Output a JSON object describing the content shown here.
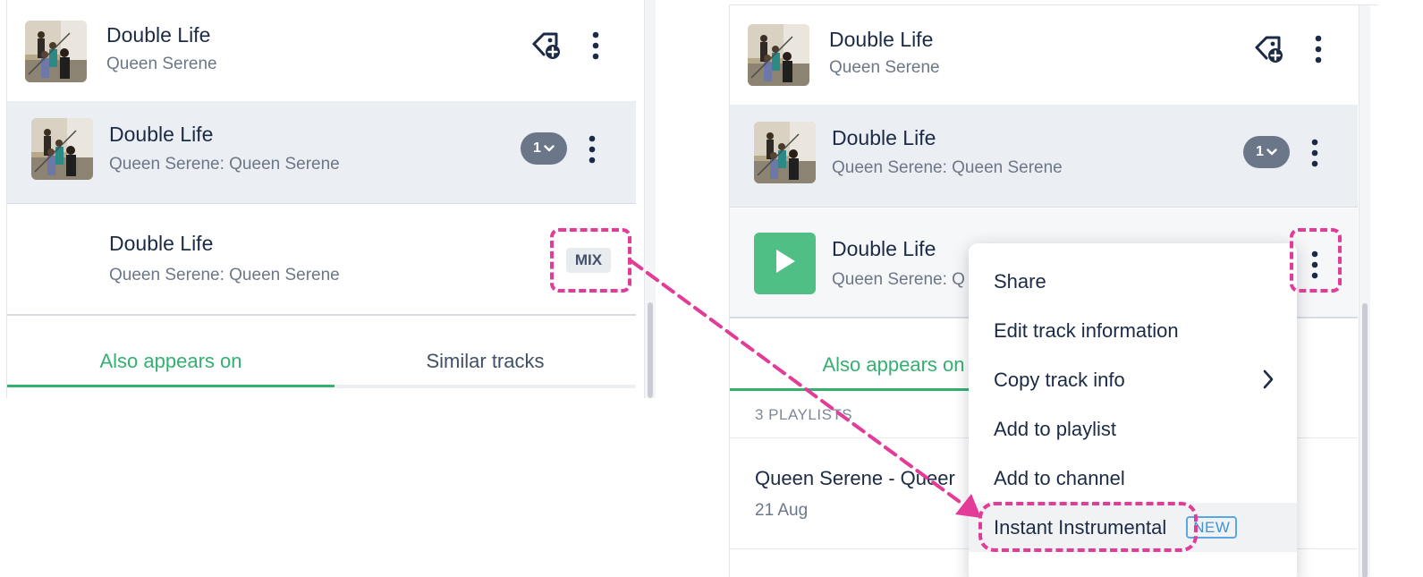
{
  "left_panel": {
    "header_track": {
      "title": "Double Life",
      "artist": "Queen Serene"
    },
    "version_track": {
      "title": "Double Life",
      "subtitle": "Queen Serene: Queen Serene",
      "count": "1"
    },
    "mix_track": {
      "title": "Double Life",
      "subtitle": "Queen Serene: Queen Serene",
      "badge": "MIX"
    },
    "tabs": [
      "Also appears on",
      "Similar tracks"
    ]
  },
  "right_panel": {
    "header_track": {
      "title": "Double Life",
      "artist": "Queen Serene"
    },
    "version_track": {
      "title": "Double Life",
      "subtitle": "Queen Serene: Queen Serene",
      "count": "1"
    },
    "mix_track": {
      "title": "Double Life",
      "subtitle": "Queen Serene: Q"
    },
    "tabs": [
      "Also appears on"
    ],
    "section_label": "3 PLAYLISTS",
    "playlist": {
      "title": "Queen Serene - Queer",
      "date": "21 Aug"
    }
  },
  "context_menu": {
    "items": [
      "Share",
      "Edit track information",
      "Copy track info",
      "Add to playlist",
      "Add to channel",
      "Instant Instrumental"
    ],
    "new_badge": "NEW"
  },
  "colors": {
    "accent_green": "#34b070",
    "annotation_pink": "#e23b98",
    "badge_gray": "#6b7689",
    "new_badge_blue": "#3e93d8"
  },
  "icons": [
    "tag-add-icon",
    "more-vertical-icon",
    "chevron-down-icon",
    "chevron-right-icon",
    "play-icon"
  ]
}
